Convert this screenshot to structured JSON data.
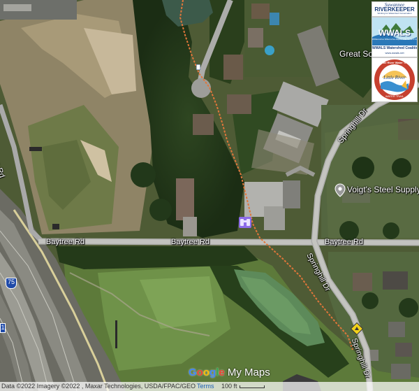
{
  "roads": {
    "baytree_west": "Baytree Rd",
    "baytree_mid": "Baytree Rd",
    "baytree_east": "Baytree Rd",
    "baytree_vertical": "Baytree Rd",
    "springhill_upper": "Springhill Dr",
    "springhill_mid": "Springhill Dr",
    "springhill_lower": "Springhill Dr",
    "interstate_shield": "75",
    "interstate_shield_partial": "1"
  },
  "places": {
    "voigts": "Voigt's Steel Supply",
    "great_south": "Great Sou"
  },
  "logos": {
    "suwannee": {
      "line1": "Suwannee",
      "line2": "RIVERKEEPER",
      "tagline": "Working for Watershed Conservation"
    },
    "wwals": {
      "name": "WWALS",
      "sub": "Withlacoochee Willacoochee Alapaha Little Santa Fe Suwannee",
      "caption": "WWALS Watershed Coalition",
      "url": "www.wwals.net"
    },
    "little_river": {
      "arc": "Little River Water Trail",
      "name": "Little River",
      "sub": "WATER TRAIL"
    }
  },
  "footer": {
    "attribution": "Data ©2022 Imagery ©2022 , Maxar Technologies, USDA/FPAC/GEO",
    "terms": "Terms",
    "scale_label": "100 ft"
  },
  "branding": {
    "google_letters": [
      "G",
      "o",
      "o",
      "g",
      "l",
      "e"
    ],
    "my_maps": " My Maps"
  },
  "colors": {
    "trail": "#e0763a",
    "road": "#a8a8a8",
    "google_blue": "#4285f4",
    "google_red": "#ea4335",
    "google_yellow": "#fbbc05",
    "google_green": "#34a853",
    "marker_purple": "#8c6be8",
    "warning_yellow": "#f2d21a"
  },
  "icons": {
    "binoculars_marker": "binoculars-icon",
    "warning_marker": "warning-icon",
    "place_pin": "location-pin-icon"
  }
}
